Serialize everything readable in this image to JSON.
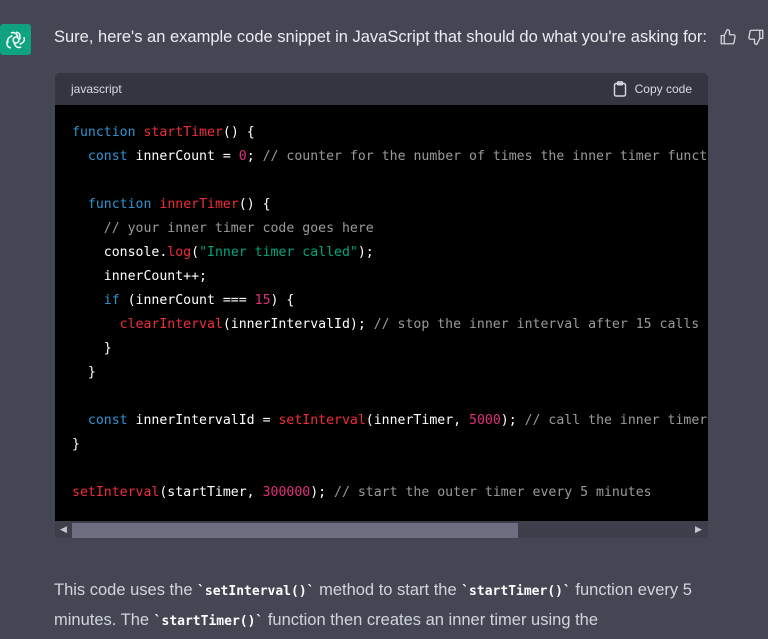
{
  "message": {
    "intro": "Sure, here's an example code snippet in JavaScript that should do what you're asking for:"
  },
  "code_block": {
    "language": "javascript",
    "copy_label": "Copy code",
    "lines": [
      "function startTimer() {",
      "  const innerCount = 0; // counter for the number of times the inner timer funct",
      "",
      "  function innerTimer() {",
      "    // your inner timer code goes here",
      "    console.log(\"Inner timer called\");",
      "    innerCount++;",
      "    if (innerCount === 15) {",
      "      clearInterval(innerIntervalId); // stop the inner interval after 15 calls",
      "    }",
      "  }",
      "",
      "  const innerIntervalId = setInterval(innerTimer, 5000); // call the inner timer",
      "}",
      "",
      "setInterval(startTimer, 300000); // start the outer timer every 5 minutes"
    ]
  },
  "explanation": {
    "t1": "This code uses the ",
    "c1": "`setInterval()`",
    "t2": " method to start the ",
    "c2": "`startTimer()`",
    "t3": " function every 5 minutes. The ",
    "c3": "`startTimer()`",
    "t4": " function then creates an inner timer using the"
  },
  "colors": {
    "background": "#444654",
    "code_bg": "#000000",
    "header_bg": "#343541",
    "avatar": "#10a37f",
    "keyword": "#2e95d3",
    "function": "#f22c3d",
    "number": "#df3079",
    "string": "#00a67d",
    "comment": "#9a9a9a"
  },
  "icons": [
    "chatgpt-logo-icon",
    "thumbs-up-icon",
    "thumbs-down-icon",
    "clipboard-icon",
    "scroll-left-icon",
    "scroll-right-icon"
  ]
}
